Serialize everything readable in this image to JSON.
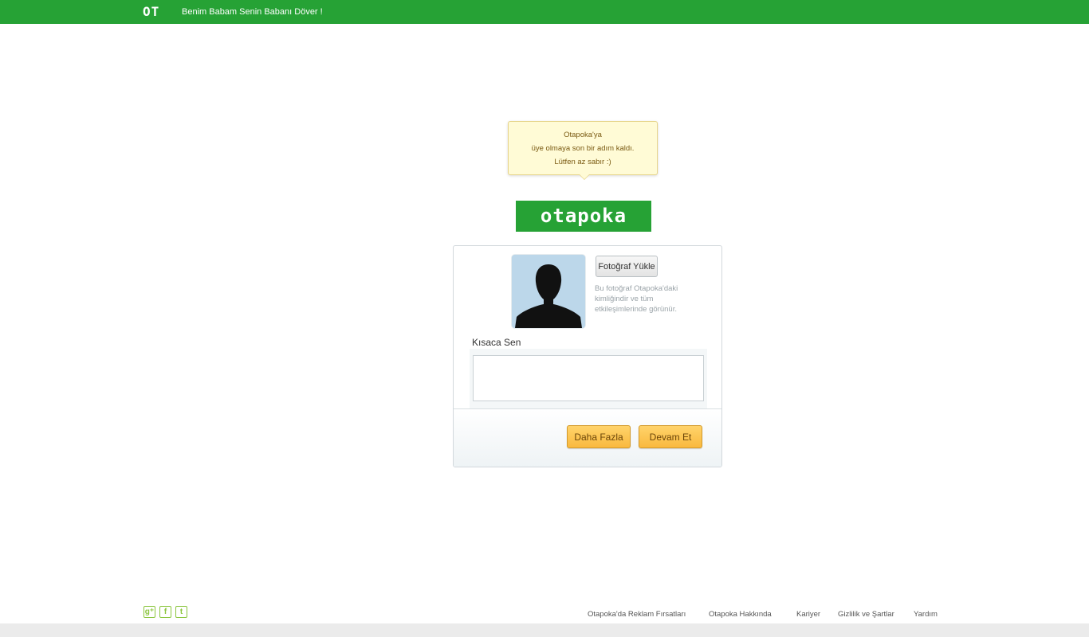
{
  "topbar": {
    "logo": "OT",
    "slogan": "Benim Babam Senin Babanı Döver !"
  },
  "tooltip": {
    "line1": "Otapoka'ya",
    "line2": "üye olmaya son bir adım kaldı.",
    "line3": "Lütfen az sabır :)"
  },
  "brand": "otapoka",
  "profile": {
    "upload_label": "Fotoğraf Yükle",
    "upload_hint": "Bu fotoğraf Otapoka'daki kimliğindir ve tüm etkileşimlerinde görünür.",
    "about_label": "Kısaca Sen",
    "about_value": "",
    "more_label": "Daha Fazla",
    "continue_label": "Devam Et"
  },
  "social": {
    "icons": [
      "google-plus-icon",
      "facebook-icon",
      "twitter-icon"
    ],
    "glyphs": [
      "g⁺",
      "f",
      "t"
    ]
  },
  "footer": {
    "links": [
      "Otapoka'da Reklam Fırsatları",
      "Otapoka Hakkında",
      "Kariyer",
      "Gizlilik ve Şartlar",
      "Yardım"
    ]
  },
  "colors": {
    "brand_green": "#26a235",
    "tooltip_bg": "#fffbd6",
    "button_orange": "#f9b93e",
    "social_green": "#8cc63f"
  }
}
